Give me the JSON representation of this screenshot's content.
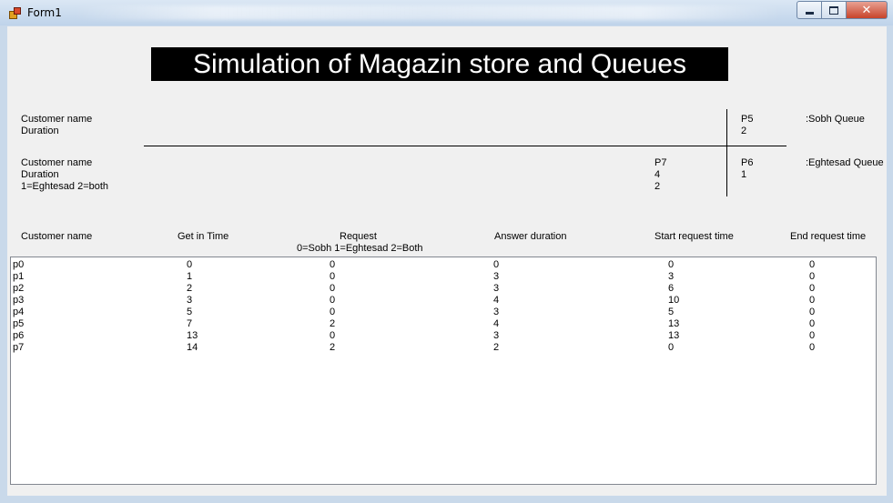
{
  "window": {
    "title": "Form1",
    "controls": {
      "minimize": "minimize",
      "maximize": "maximize",
      "close": "close"
    }
  },
  "heading": "Simulation of Magazin store and Queues",
  "sobh_panel": {
    "label_name": "Customer name",
    "label_duration": "Duration",
    "value_name": "P5",
    "value_duration": "2",
    "queue_label": ":Sobh Queue"
  },
  "eghtesad_panel": {
    "label_name": "Customer name",
    "label_duration": "Duration",
    "label_type": "1=Eghtesad 2=both",
    "waiting_name": "P7",
    "waiting_duration": "4",
    "waiting_type": "2",
    "value_name": "P6",
    "value_duration": "1",
    "queue_label": ":Eghtesad Queue"
  },
  "table": {
    "headers": {
      "customer_name": "Customer name",
      "get_in_time": "Get in Time",
      "request": "Request",
      "request_legend": "0=Sobh 1=Eghtesad 2=Both",
      "answer_duration": "Answer duration",
      "start_request_time": "Start request time",
      "end_request_time": "End request time"
    },
    "rows": [
      {
        "name": "p0",
        "get_in": "0",
        "request": "0",
        "answer": "0",
        "start": "0",
        "end": "0"
      },
      {
        "name": "p1",
        "get_in": "1",
        "request": "0",
        "answer": "3",
        "start": "3",
        "end": "0"
      },
      {
        "name": "p2",
        "get_in": "2",
        "request": "0",
        "answer": "3",
        "start": "6",
        "end": "0"
      },
      {
        "name": "p3",
        "get_in": "3",
        "request": "0",
        "answer": "4",
        "start": "10",
        "end": "0"
      },
      {
        "name": "p4",
        "get_in": "5",
        "request": "0",
        "answer": "3",
        "start": "5",
        "end": "0"
      },
      {
        "name": "p5",
        "get_in": "7",
        "request": "2",
        "answer": "4",
        "start": "13",
        "end": "0"
      },
      {
        "name": "p6",
        "get_in": "13",
        "request": "0",
        "answer": "3",
        "start": "13",
        "end": "0"
      },
      {
        "name": "p7",
        "get_in": "14",
        "request": "2",
        "answer": "2",
        "start": "0",
        "end": "0"
      }
    ]
  }
}
